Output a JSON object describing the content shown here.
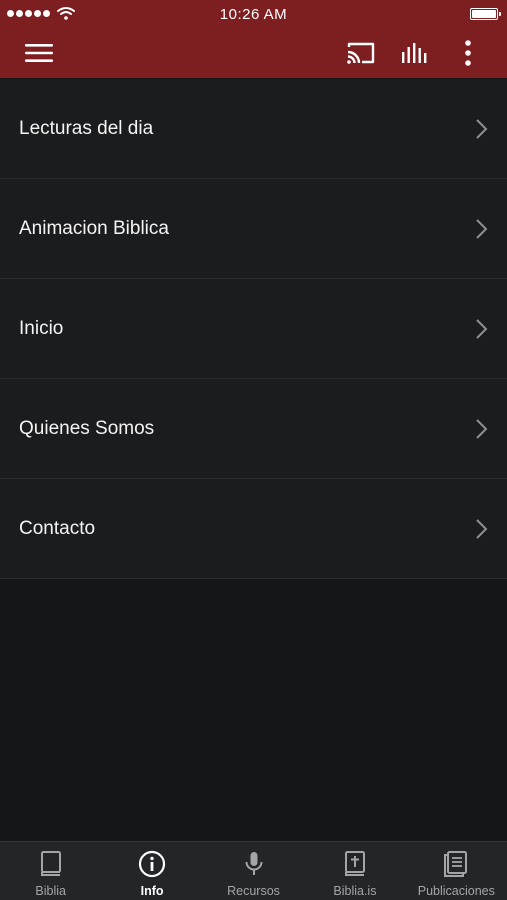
{
  "status_bar": {
    "time": "10:26 AM"
  },
  "toolbar": {
    "menu_icon": "hamburger-menu-icon",
    "cast_icon": "cast-icon",
    "equalizer_icon": "equalizer-icon",
    "more_icon": "more-vertical-icon"
  },
  "menu": {
    "items": [
      {
        "label": "Lecturas del dia"
      },
      {
        "label": "Animacion Biblica"
      },
      {
        "label": "Inicio"
      },
      {
        "label": "Quienes Somos"
      },
      {
        "label": "Contacto"
      }
    ]
  },
  "tabs": [
    {
      "label": "Biblia",
      "icon": "book-icon",
      "active": false
    },
    {
      "label": "Info",
      "icon": "info-icon",
      "active": true
    },
    {
      "label": "Recursos",
      "icon": "microphone-icon",
      "active": false
    },
    {
      "label": "Biblia.is",
      "icon": "bible-cross-icon",
      "active": false
    },
    {
      "label": "Publicaciones",
      "icon": "publications-icon",
      "active": false
    }
  ],
  "colors": {
    "header_bg": "#7d1f21",
    "background": "#151618",
    "row_bg": "#1b1c1e",
    "tabbar_bg": "#242528",
    "active_tab": "#ffffff",
    "inactive_tab": "#a4a5a8"
  }
}
